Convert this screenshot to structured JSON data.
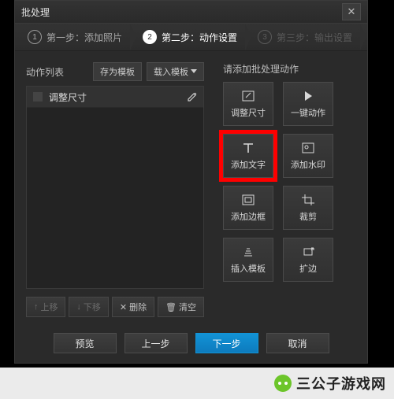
{
  "window": {
    "title": "批处理"
  },
  "steps": {
    "s1": "第一步：添加照片",
    "s2": "第二步：动作设置",
    "s3": "第三步：输出设置"
  },
  "left": {
    "label": "动作列表",
    "save_tpl": "存为模板",
    "load_tpl": "载入模板",
    "item1": "调整尺寸",
    "btn_up": "上移",
    "btn_down": "下移",
    "btn_del": "删除",
    "btn_clear": "清空"
  },
  "right": {
    "label": "请添加批处理动作",
    "tiles": {
      "resize": "调整尺寸",
      "auto": "一键动作",
      "text": "添加文字",
      "wm": "添加水印",
      "border": "添加边框",
      "crop": "裁剪",
      "insert": "插入模板",
      "extend": "扩边"
    }
  },
  "footer": {
    "preview": "预览",
    "prev": "上一步",
    "next": "下一步",
    "cancel": "取消"
  },
  "watermark": "三公子游戏网"
}
